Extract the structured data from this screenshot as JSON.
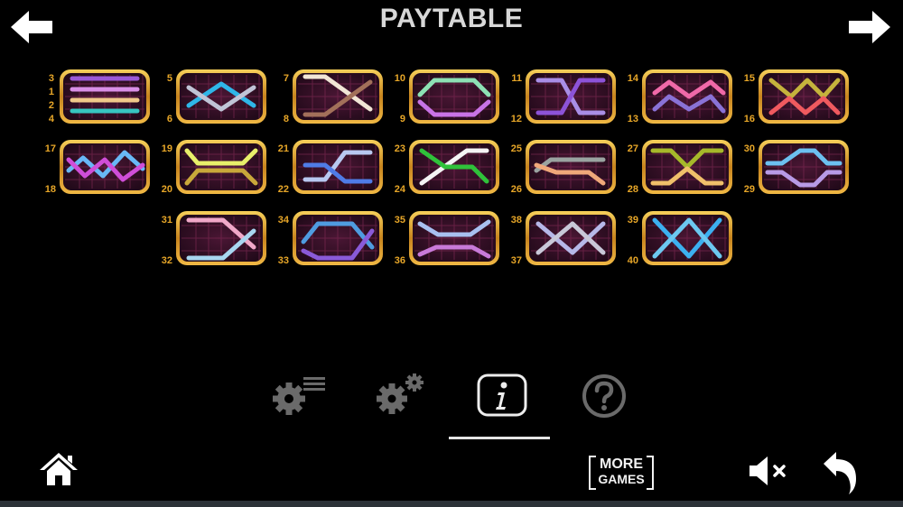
{
  "header": {
    "title": "PAYTABLE",
    "prev_icon": "arrow-left-icon",
    "next_icon": "arrow-right-icon"
  },
  "paylines": [
    {
      "numbers": [
        "3",
        "1",
        "2",
        "4"
      ],
      "colors": [
        "#9a59d6",
        "#d98fe6",
        "#f1c98a",
        "#37c6c0"
      ]
    },
    {
      "numbers": [
        "5",
        "6"
      ],
      "colors": [
        "#2fb6e8",
        "#c0c4d6"
      ]
    },
    {
      "numbers": [
        "7",
        "8"
      ],
      "colors": [
        "#f2e6d6",
        "#a2705a"
      ]
    },
    {
      "numbers": [
        "10",
        "9"
      ],
      "colors": [
        "#8de0b4",
        "#c873e6"
      ]
    },
    {
      "numbers": [
        "11",
        "12"
      ],
      "colors": [
        "#a98ee6",
        "#8d53d8"
      ]
    },
    {
      "numbers": [
        "14",
        "13"
      ],
      "colors": [
        "#f069a8",
        "#8a72d6"
      ]
    },
    {
      "numbers": [
        "15",
        "16"
      ],
      "colors": [
        "#c5b33c",
        "#f05a5f"
      ]
    },
    {
      "numbers": [
        "17",
        "18"
      ],
      "colors": [
        "#68b8f6",
        "#d04ed8"
      ]
    },
    {
      "numbers": [
        "19",
        "20"
      ],
      "colors": [
        "#e8f06a",
        "#c9a83a"
      ]
    },
    {
      "numbers": [
        "21",
        "22"
      ],
      "colors": [
        "#b8c8f0",
        "#4f7ce6"
      ]
    },
    {
      "numbers": [
        "23",
        "24"
      ],
      "colors": [
        "#f4f4f4",
        "#2fc23a"
      ]
    },
    {
      "numbers": [
        "25",
        "26"
      ],
      "colors": [
        "#9aa3a0",
        "#f0a87a"
      ]
    },
    {
      "numbers": [
        "27",
        "28"
      ],
      "colors": [
        "#a6b82a",
        "#f0c06a"
      ]
    },
    {
      "numbers": [
        "30",
        "29"
      ],
      "colors": [
        "#6cc0f0",
        "#b89ae6"
      ]
    },
    {
      "numbers": [
        "31",
        "32"
      ],
      "colors": [
        "#f0a8c8",
        "#a8d6f0"
      ]
    },
    {
      "numbers": [
        "34",
        "33"
      ],
      "colors": [
        "#4f9ce0",
        "#8a5ad8"
      ]
    },
    {
      "numbers": [
        "35",
        "36"
      ],
      "colors": [
        "#a8c0f0",
        "#c87ad8"
      ]
    },
    {
      "numbers": [
        "38",
        "37"
      ],
      "colors": [
        "#b6b8e8",
        "#c8c8d8"
      ]
    },
    {
      "numbers": [
        "39",
        "40"
      ],
      "colors": [
        "#3cb0f0",
        "#6cc8f0"
      ]
    }
  ],
  "tabs": [
    {
      "icon": "settings-list-icon"
    },
    {
      "icon": "gears-icon"
    },
    {
      "icon": "info-icon",
      "active": true
    },
    {
      "icon": "help-icon"
    }
  ],
  "footer": {
    "home_icon": "home-icon",
    "more_games_line1": "MORE",
    "more_games_line2": "GAMES",
    "mute_icon": "speaker-muted-icon",
    "back_icon": "back-icon"
  },
  "colors": {
    "frame_gold": "#d99a2b",
    "frame_inner": "#3c0f2a",
    "number_color": "#e7a628",
    "icon_gray": "#6a6a6a",
    "active_tab": "#ededed"
  }
}
